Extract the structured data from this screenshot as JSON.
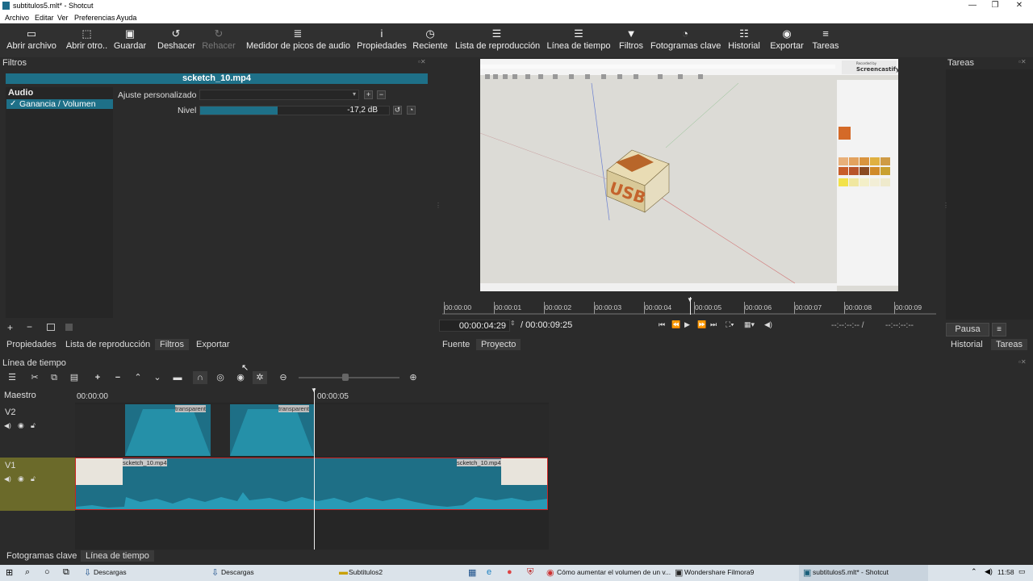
{
  "window": {
    "title": "subtitulos5.mlt* - Shotcut",
    "minimize": "—",
    "maximize": "❐",
    "close": "✕"
  },
  "menu": [
    "Archivo",
    "Editar",
    "Ver",
    "Preferencias",
    "Ayuda"
  ],
  "toolbar": [
    {
      "label": "Abrir archivo",
      "icon": "folder-icon",
      "glyph": "▭"
    },
    {
      "label": "Abrir otro..",
      "icon": "open-other-icon",
      "glyph": "⬚"
    },
    {
      "label": "Guardar",
      "icon": "save-icon",
      "glyph": "▣"
    },
    {
      "label": "Deshacer",
      "icon": "undo-icon",
      "glyph": "↺"
    },
    {
      "label": "Rehacer",
      "icon": "redo-icon",
      "glyph": "↻"
    },
    {
      "label": "Medidor de picos de audio",
      "icon": "audio-meter-icon",
      "glyph": "≣"
    },
    {
      "label": "Propiedades",
      "icon": "info-icon",
      "glyph": "i"
    },
    {
      "label": "Reciente",
      "icon": "clock-icon",
      "glyph": "◷"
    },
    {
      "label": "Lista de reproducción",
      "icon": "list-icon",
      "glyph": "☰"
    },
    {
      "label": "Línea de tiempo",
      "icon": "timeline-icon",
      "glyph": "☰"
    },
    {
      "label": "Filtros",
      "icon": "filter-icon",
      "glyph": "▼"
    },
    {
      "label": "Fotogramas clave",
      "icon": "stopwatch-icon",
      "glyph": "◔"
    },
    {
      "label": "Historial",
      "icon": "history-icon",
      "glyph": "☷"
    },
    {
      "label": "Exportar",
      "icon": "export-icon",
      "glyph": "◉"
    },
    {
      "label": "Tareas",
      "icon": "tasks-icon",
      "glyph": "≡"
    }
  ],
  "filters": {
    "title": "Filtros",
    "clip": "scketch_10.mp4",
    "category": "Audio",
    "item": "Ganancia / Volumen",
    "check": "✓",
    "preset_label": "Ajuste personalizado",
    "preset_value": "",
    "level_label": "Nivel",
    "level_value": "-17,2 dB",
    "level_fraction": 0.41
  },
  "left_tabs": [
    "Propiedades",
    "Lista de reproducción",
    "Filtros",
    "Exportar"
  ],
  "ruler": [
    "00:00:00",
    "00:00:01",
    "00:00:02",
    "00:00:03",
    "00:00:04",
    "00:00:05",
    "00:00:06",
    "00:00:07",
    "00:00:08",
    "00:00:09"
  ],
  "transport": {
    "current": "00:00:04:29",
    "total": "/ 00:00:09:25",
    "in": "--:--:--:-- /",
    "out": "--:--:--:--"
  },
  "viewer_tabs": [
    "Fuente",
    "Proyecto"
  ],
  "tasks": {
    "title": "Tareas",
    "pause": "Pausa",
    "menu": "≡",
    "tabs": [
      "Historial",
      "Tareas"
    ]
  },
  "timeline": {
    "title": "Línea de tiempo",
    "master": "Maestro",
    "start_tc": "00:00:00",
    "mid_tc": "00:00:05",
    "tracks": [
      {
        "name": "V2"
      },
      {
        "name": "V1"
      }
    ],
    "v2_clips": [
      "transparent",
      "transparent"
    ],
    "v1_clips": [
      "scketch_10.mp4",
      "scketch_10.mp4"
    ]
  },
  "bottom_tabs": [
    "Fotogramas clave",
    "Línea de tiempo"
  ],
  "viewer_overlay": {
    "watermark_small": "Recorded by",
    "watermark": "Screencastify",
    "logo": "USB"
  },
  "taskbar": {
    "items": [
      "Descargas",
      "Descargas",
      "Subtitulos2",
      "Cómo aumentar el volumen de un v...",
      "Wondershare Filmora9",
      "subtitulos5.mlt* - Shotcut"
    ],
    "time": "11:58"
  }
}
